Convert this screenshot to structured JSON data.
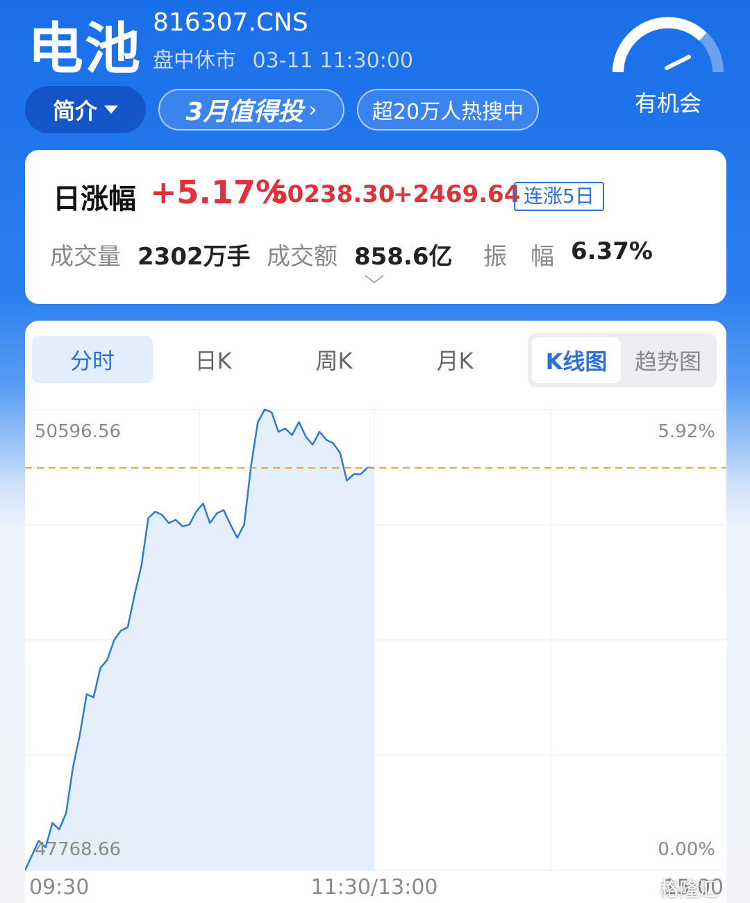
{
  "header": {
    "title": "电池",
    "code": "816307.CNS",
    "status": "盘中休市",
    "datetime": "03-11 11:30:00",
    "intro_label": "简介",
    "promo_label": "3月值得投",
    "hot_label": "超20万人热搜中",
    "gauge_label": "有机会"
  },
  "summary": {
    "label": "日涨幅",
    "change_pct": "+5.17%",
    "price": "50238.30",
    "change": "+2469.64",
    "streak_badge": "连涨5日",
    "volume_label": "成交量",
    "volume_value": "2302万手",
    "amount_label": "成交额",
    "amount_value": "858.6亿",
    "amplitude_label": "振　幅",
    "amplitude_value": "6.37%"
  },
  "chart_tabs": [
    "分时",
    "日K",
    "周K",
    "月K"
  ],
  "chart_mode": {
    "active": "K线图",
    "inactive": "趋势图"
  },
  "colors": {
    "line": "#2d7ad6",
    "fill": "#e4effb",
    "ref_line": "#f0a020",
    "up": "#e0303a",
    "accent": "#2d6fd8"
  },
  "chart_data": {
    "type": "area",
    "ylim": [
      47768.66,
      50596.56
    ],
    "y_tick_left": [
      "50596.56",
      "47768.66"
    ],
    "y_tick_right": [
      "5.92%",
      "0.00%"
    ],
    "x_ticks": [
      "09:30",
      "11:30/13:00",
      "15:00"
    ],
    "reference_price": 50238.3,
    "series": [
      {
        "values": [
          47768.66,
          47860,
          47950,
          47910,
          48060,
          48020,
          48120,
          48400,
          48600,
          48850,
          48830,
          49010,
          49060,
          49180,
          49240,
          49260,
          49460,
          49640,
          49930,
          49970,
          49950,
          49900,
          49920,
          49880,
          49890,
          49970,
          50020,
          49900,
          49960,
          49980,
          49890,
          49810,
          49890,
          50250,
          50520,
          50596.56,
          50580,
          50460,
          50480,
          50440,
          50520,
          50430,
          50380,
          50460,
          50410,
          50390,
          50330,
          50160,
          50200,
          50200,
          50240,
          50238.3
        ]
      }
    ]
  },
  "watermark": "格隆汇"
}
